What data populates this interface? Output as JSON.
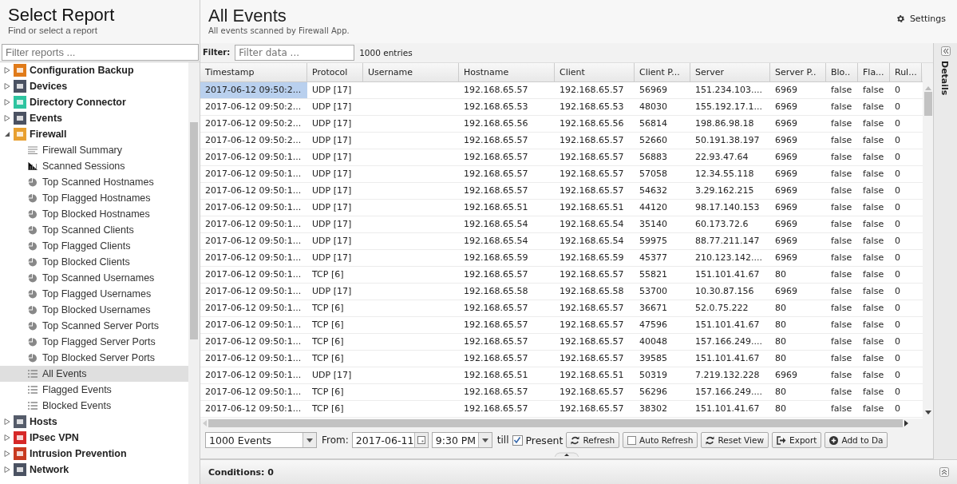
{
  "sidebar": {
    "title": "Select Report",
    "subtitle": "Find or select a report",
    "filter": {
      "placeholder": "Filter reports ..."
    },
    "tree": [
      {
        "label": "Configuration Backup",
        "color": "#e07b1a",
        "expanded": false
      },
      {
        "label": "Devices",
        "color": "#4b5262",
        "expanded": false
      },
      {
        "label": "Directory Connector",
        "color": "#2ec4a0",
        "expanded": false
      },
      {
        "label": "Events",
        "color": "#4b5262",
        "expanded": false
      },
      {
        "label": "Firewall",
        "color": "#e8a030",
        "expanded": true,
        "children": [
          {
            "label": "Firewall Summary",
            "kind": "text",
            "selected": false
          },
          {
            "label": "Scanned Sessions",
            "kind": "bars",
            "selected": false
          },
          {
            "label": "Top Scanned Hostnames",
            "kind": "pie",
            "selected": false
          },
          {
            "label": "Top Flagged Hostnames",
            "kind": "pie",
            "selected": false
          },
          {
            "label": "Top Blocked Hostnames",
            "kind": "pie",
            "selected": false
          },
          {
            "label": "Top Scanned Clients",
            "kind": "pie",
            "selected": false
          },
          {
            "label": "Top Flagged Clients",
            "kind": "pie",
            "selected": false
          },
          {
            "label": "Top Blocked Clients",
            "kind": "pie",
            "selected": false
          },
          {
            "label": "Top Scanned Usernames",
            "kind": "pie",
            "selected": false
          },
          {
            "label": "Top Flagged Usernames",
            "kind": "pie",
            "selected": false
          },
          {
            "label": "Top Blocked Usernames",
            "kind": "pie",
            "selected": false
          },
          {
            "label": "Top Scanned Server Ports",
            "kind": "pie",
            "selected": false
          },
          {
            "label": "Top Flagged Server Ports",
            "kind": "pie",
            "selected": false
          },
          {
            "label": "Top Blocked Server Ports",
            "kind": "pie",
            "selected": false
          },
          {
            "label": "All Events",
            "kind": "list",
            "selected": true
          },
          {
            "label": "Flagged Events",
            "kind": "list",
            "selected": false
          },
          {
            "label": "Blocked Events",
            "kind": "list",
            "selected": false
          }
        ]
      },
      {
        "label": "Hosts",
        "color": "#555c6a",
        "expanded": false
      },
      {
        "label": "IPsec VPN",
        "color": "#d62828",
        "expanded": false
      },
      {
        "label": "Intrusion Prevention",
        "color": "#c83a20",
        "expanded": false
      },
      {
        "label": "Network",
        "color": "#4b5262",
        "expanded": false
      }
    ]
  },
  "main": {
    "title": "All Events",
    "subtitle": "All events scanned by Firewall App.",
    "settings": "Settings",
    "filter": {
      "label": "Filter:",
      "placeholder": "Filter data ...",
      "count": "1000 entries"
    },
    "details": "Details",
    "table": {
      "columns": [
        "Timestamp",
        "Protocol",
        "Username",
        "Hostname",
        "Client",
        "Client P...",
        "Server",
        "Server P..",
        "Blo..",
        "Fla...",
        "Rul..."
      ],
      "rows": [
        {
          "selected": true,
          "cells": [
            "2017-06-12 09:50:2...",
            "UDP [17]",
            "",
            "192.168.65.57",
            "192.168.65.57",
            "56969",
            "151.234.103....",
            "6969",
            "false",
            "false",
            "0"
          ]
        },
        {
          "selected": false,
          "cells": [
            "2017-06-12 09:50:2...",
            "UDP [17]",
            "",
            "192.168.65.53",
            "192.168.65.53",
            "48030",
            "155.192.17.1...",
            "6969",
            "false",
            "false",
            "0"
          ]
        },
        {
          "selected": false,
          "cells": [
            "2017-06-12 09:50:2...",
            "UDP [17]",
            "",
            "192.168.65.56",
            "192.168.65.56",
            "56814",
            "198.86.98.18",
            "6969",
            "false",
            "false",
            "0"
          ]
        },
        {
          "selected": false,
          "cells": [
            "2017-06-12 09:50:2...",
            "UDP [17]",
            "",
            "192.168.65.57",
            "192.168.65.57",
            "52660",
            "50.191.38.197",
            "6969",
            "false",
            "false",
            "0"
          ]
        },
        {
          "selected": false,
          "cells": [
            "2017-06-12 09:50:1...",
            "UDP [17]",
            "",
            "192.168.65.57",
            "192.168.65.57",
            "56883",
            "22.93.47.64",
            "6969",
            "false",
            "false",
            "0"
          ]
        },
        {
          "selected": false,
          "cells": [
            "2017-06-12 09:50:1...",
            "UDP [17]",
            "",
            "192.168.65.57",
            "192.168.65.57",
            "57058",
            "12.34.55.118",
            "6969",
            "false",
            "false",
            "0"
          ]
        },
        {
          "selected": false,
          "cells": [
            "2017-06-12 09:50:1...",
            "UDP [17]",
            "",
            "192.168.65.57",
            "192.168.65.57",
            "54632",
            "3.29.162.215",
            "6969",
            "false",
            "false",
            "0"
          ]
        },
        {
          "selected": false,
          "cells": [
            "2017-06-12 09:50:1...",
            "UDP [17]",
            "",
            "192.168.65.51",
            "192.168.65.51",
            "44120",
            "98.17.140.153",
            "6969",
            "false",
            "false",
            "0"
          ]
        },
        {
          "selected": false,
          "cells": [
            "2017-06-12 09:50:1...",
            "UDP [17]",
            "",
            "192.168.65.54",
            "192.168.65.54",
            "35140",
            "60.173.72.6",
            "6969",
            "false",
            "false",
            "0"
          ]
        },
        {
          "selected": false,
          "cells": [
            "2017-06-12 09:50:1...",
            "UDP [17]",
            "",
            "192.168.65.54",
            "192.168.65.54",
            "59975",
            "88.77.211.147",
            "6969",
            "false",
            "false",
            "0"
          ]
        },
        {
          "selected": false,
          "cells": [
            "2017-06-12 09:50:1...",
            "UDP [17]",
            "",
            "192.168.65.59",
            "192.168.65.59",
            "45377",
            "210.123.142....",
            "6969",
            "false",
            "false",
            "0"
          ]
        },
        {
          "selected": false,
          "cells": [
            "2017-06-12 09:50:1...",
            "TCP [6]",
            "",
            "192.168.65.57",
            "192.168.65.57",
            "55821",
            "151.101.41.67",
            "80",
            "false",
            "false",
            "0"
          ]
        },
        {
          "selected": false,
          "cells": [
            "2017-06-12 09:50:1...",
            "UDP [17]",
            "",
            "192.168.65.58",
            "192.168.65.58",
            "53700",
            "10.30.87.156",
            "6969",
            "false",
            "false",
            "0"
          ]
        },
        {
          "selected": false,
          "cells": [
            "2017-06-12 09:50:1...",
            "TCP [6]",
            "",
            "192.168.65.57",
            "192.168.65.57",
            "36671",
            "52.0.75.222",
            "80",
            "false",
            "false",
            "0"
          ]
        },
        {
          "selected": false,
          "cells": [
            "2017-06-12 09:50:1...",
            "TCP [6]",
            "",
            "192.168.65.57",
            "192.168.65.57",
            "47596",
            "151.101.41.67",
            "80",
            "false",
            "false",
            "0"
          ]
        },
        {
          "selected": false,
          "cells": [
            "2017-06-12 09:50:1...",
            "TCP [6]",
            "",
            "192.168.65.57",
            "192.168.65.57",
            "40048",
            "157.166.249....",
            "80",
            "false",
            "false",
            "0"
          ]
        },
        {
          "selected": false,
          "cells": [
            "2017-06-12 09:50:1...",
            "TCP [6]",
            "",
            "192.168.65.57",
            "192.168.65.57",
            "39585",
            "151.101.41.67",
            "80",
            "false",
            "false",
            "0"
          ]
        },
        {
          "selected": false,
          "cells": [
            "2017-06-12 09:50:1...",
            "UDP [17]",
            "",
            "192.168.65.51",
            "192.168.65.51",
            "50319",
            "7.219.132.228",
            "6969",
            "false",
            "false",
            "0"
          ]
        },
        {
          "selected": false,
          "cells": [
            "2017-06-12 09:50:1...",
            "TCP [6]",
            "",
            "192.168.65.57",
            "192.168.65.57",
            "56296",
            "157.166.249....",
            "80",
            "false",
            "false",
            "0"
          ]
        },
        {
          "selected": false,
          "cells": [
            "2017-06-12 09:50:1...",
            "TCP [6]",
            "",
            "192.168.65.57",
            "192.168.65.57",
            "38302",
            "151.101.41.67",
            "80",
            "false",
            "false",
            "0"
          ]
        }
      ]
    },
    "toolbar": {
      "limit": "1000 Events",
      "from_label": "From:",
      "date": "2017-06-11",
      "time": "9:30 PM",
      "till": "till",
      "present": {
        "label": "Present",
        "checked": true
      },
      "buttons": [
        {
          "label": "Refresh",
          "kind": "refresh"
        },
        {
          "label": "Auto Refresh",
          "kind": "checkbox",
          "checked": false
        },
        {
          "label": "Reset View",
          "kind": "refresh"
        },
        {
          "label": "Export",
          "kind": "export"
        },
        {
          "label": "Add to Da",
          "kind": "add"
        }
      ]
    },
    "conditions": "Conditions: 0"
  }
}
